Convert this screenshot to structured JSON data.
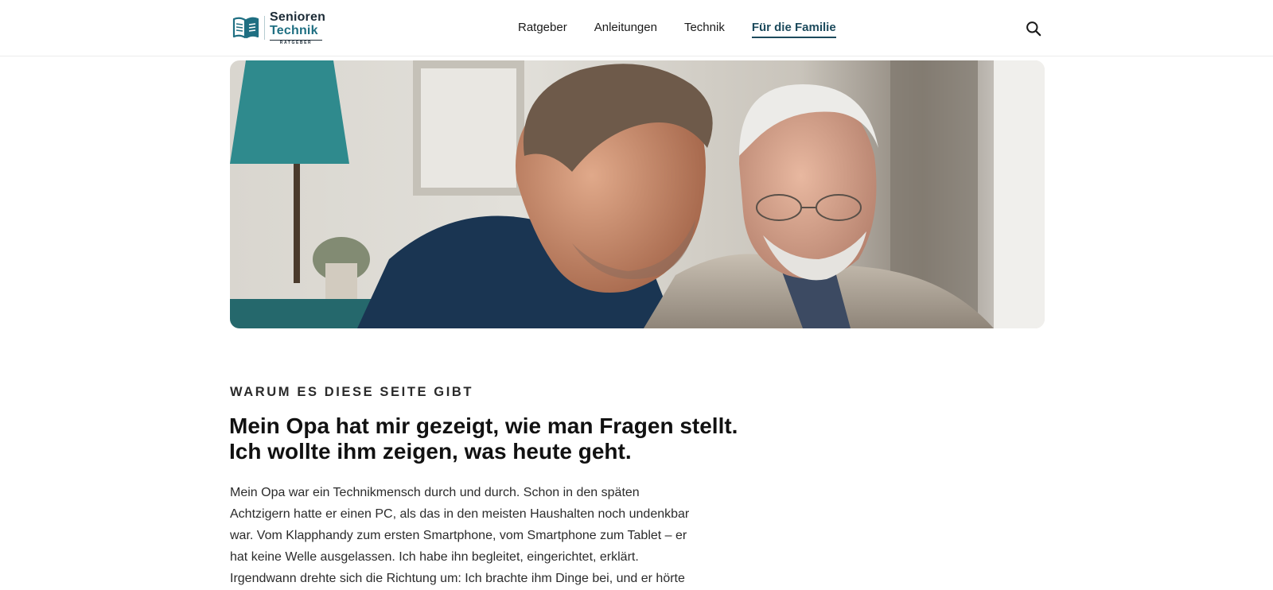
{
  "header": {
    "logo": {
      "line1": "Senioren",
      "line2": "Technik",
      "line3": "RATGEBER",
      "icon": "open-book-icon"
    },
    "nav": [
      {
        "label": "Ratgeber",
        "active": false
      },
      {
        "label": "Anleitungen",
        "active": false
      },
      {
        "label": "Technik",
        "active": false
      },
      {
        "label": "Für die Familie",
        "active": true
      }
    ],
    "search_icon": "search-icon"
  },
  "hero": {
    "image": "photo-younger-man-and-grandfather-looking-at-device"
  },
  "article": {
    "eyebrow": "Warum es diese Seite gibt",
    "headline_line1": "Mein Opa hat mir gezeigt, wie man Fragen stellt.",
    "headline_line2": "Ich wollte ihm zeigen, was heute geht.",
    "body_lines": [
      "Mein Opa war ein Technikmensch durch und durch. Schon in den späten",
      "Achtzigern hatte er einen PC, als das in den meisten Haushalten noch undenkbar",
      "war. Vom Klapphandy zum ersten Smartphone, vom Smartphone zum Tablet – er",
      "hat keine Welle ausgelassen. Ich habe ihn begleitet, eingerichtet, erklärt.",
      "Irgendwann drehte sich die Richtung um: Ich brachte ihm Dinge bei, und er hörte"
    ]
  },
  "colors": {
    "accent": "#1c4a5c",
    "logo_teal": "#1f6f82",
    "text": "#1a1a1a"
  }
}
